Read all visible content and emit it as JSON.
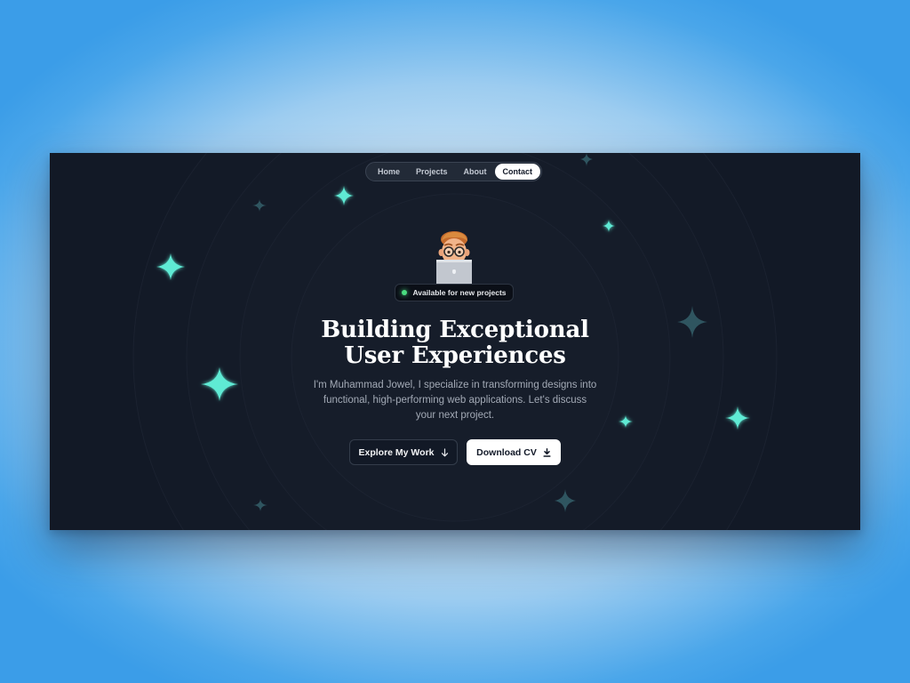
{
  "nav": {
    "items": [
      {
        "label": "Home"
      },
      {
        "label": "Projects"
      },
      {
        "label": "About"
      },
      {
        "label": "Contact"
      }
    ],
    "active": "Contact"
  },
  "hero": {
    "avatar_icon": "memoji-avatar-with-laptop",
    "badge": "Available for new projects",
    "badge_status_color": "#4ade80",
    "title_line1": "Building Exceptional",
    "title_line2": "User Experiences",
    "description": "I'm Muhammad Jowel, I specialize in transforming designs into functional, high-performing web applications. Let's discuss your next project."
  },
  "buttons": {
    "explore_label": "Explore My Work",
    "explore_icon": "arrow-down-icon",
    "download_label": "Download CV",
    "download_icon": "download-icon"
  },
  "colors": {
    "page_background": "#121926",
    "star_green": "#5eead4",
    "star_dim": "#2f5560",
    "outer_backdrop": "#3b9de8"
  }
}
